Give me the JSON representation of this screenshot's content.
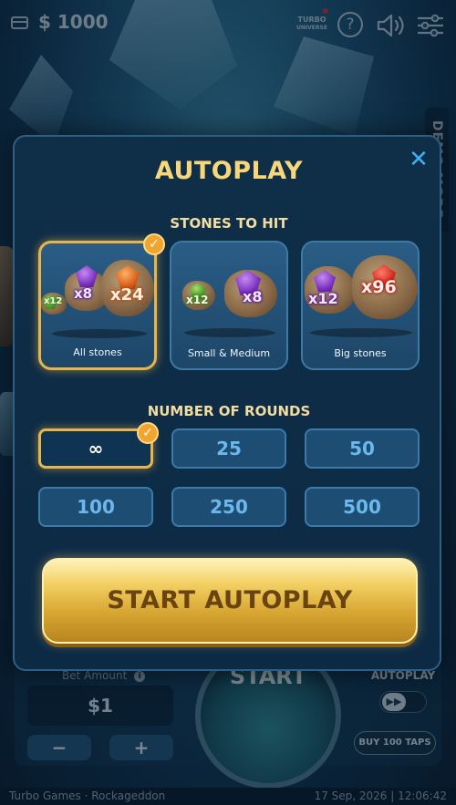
{
  "top_bar": {
    "balance": "$ 1000",
    "logo_line1": "TURBO",
    "logo_line2": "UNIVERSE",
    "help_label": "?"
  },
  "demo_tab": {
    "label": "DEMO MODE"
  },
  "modal": {
    "title": "AUTOPLAY",
    "close_label": "✕",
    "stones_title": "STONES TO HIT",
    "stone_options": [
      {
        "label": "All stones",
        "selected": true,
        "multipliers": [
          "x12",
          "x8",
          "x24"
        ]
      },
      {
        "label": "Small & Medium",
        "selected": false,
        "multipliers": [
          "x12",
          "x8"
        ]
      },
      {
        "label": "Big stones",
        "selected": false,
        "multipliers": [
          "x12",
          "x96"
        ]
      }
    ],
    "rounds_title": "NUMBER OF ROUNDS",
    "round_options": [
      {
        "label": "∞",
        "selected": true
      },
      {
        "label": "25",
        "selected": false
      },
      {
        "label": "50",
        "selected": false
      },
      {
        "label": "100",
        "selected": false
      },
      {
        "label": "250",
        "selected": false
      },
      {
        "label": "500",
        "selected": false
      }
    ],
    "start_button": "START AUTOPLAY",
    "check_glyph": "✓"
  },
  "bet_panel": {
    "label": "Bet Amount",
    "info": "i",
    "amount": "$1",
    "minus": "−",
    "plus": "+",
    "start": "START",
    "autoplay_label": "AUTOPLAY",
    "toggle_glyph": "▶▶",
    "buy_taps": "BUY 100 TAPS"
  },
  "footer": {
    "left": "Turbo Games · Rockageddon",
    "right": "17 Sep, 2026 | 12:06:42"
  },
  "colors": {
    "accent_gold": "#e9b54a",
    "title_gold": "#f7d77a",
    "round_text": "#6ab8ec",
    "close_blue": "#3fb1f0"
  }
}
